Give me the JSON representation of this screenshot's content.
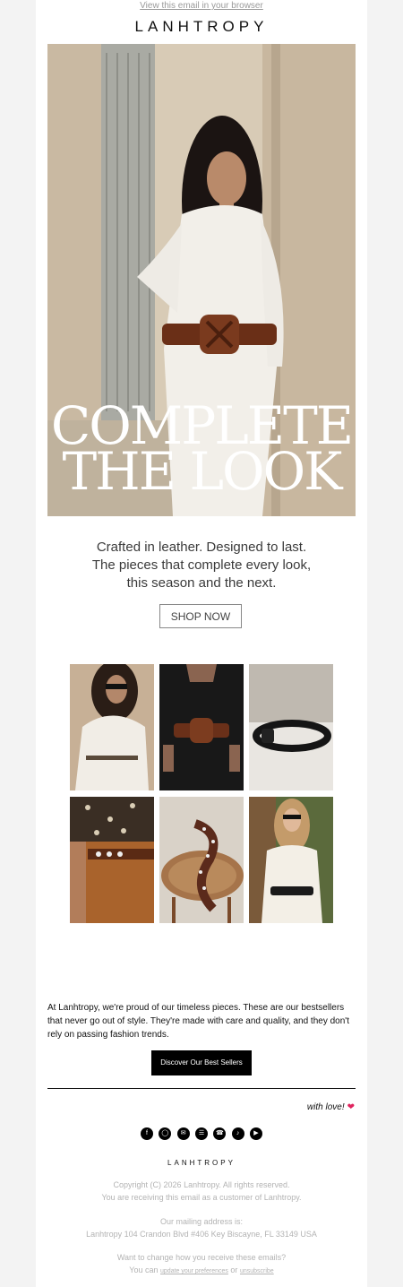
{
  "header": {
    "view_link": "View this email in your browser",
    "logo": "LANHTROPY"
  },
  "hero": {
    "line1": "COMPLETE",
    "line2": "THE LOOK"
  },
  "intro": {
    "line1": "Crafted in leather. Designed to last.",
    "line2": "The pieces that complete every look,",
    "line3": "this season and the next.",
    "button": "SHOP NOW"
  },
  "gallery": {
    "items": [
      "woman-sunglasses-white-blouse",
      "black-outfit-brown-belt",
      "black-belt-product",
      "brown-belt-trousers",
      "belt-on-chair",
      "woman-black-belt-white-dress"
    ]
  },
  "bestsellers": {
    "text": "At Lanhtropy, we're proud of our timeless pieces. These are our bestsellers that never go out of style. They're made with care and quality, and they don't rely on passing fashion trends.",
    "button": "Discover Our Best Sellers"
  },
  "sign_off": "with love!",
  "socials": [
    "facebook-icon",
    "instagram-icon",
    "email-icon",
    "website-icon",
    "whatsapp-icon",
    "tiktok-icon",
    "youtube-icon"
  ],
  "footer": {
    "logo": "LANHTROPY",
    "copyright": "Copyright (C) 2026 Lanhtropy. All rights reserved.",
    "reason": "You are receiving this email as a customer of Lanhtropy.",
    "mailing_label": "Our mailing address is:",
    "address": "Lanhtropy 104 Crandon Blvd #406 Key Biscayne, FL 33149 USA",
    "change_q": "Want to change how you receive these emails?",
    "you_can": "You can",
    "update_link": "update your preferences",
    "or": "or",
    "unsubscribe_link": "unsubscribe"
  },
  "colors": {
    "background": "#f3f3f3",
    "email_bg": "#ffffff",
    "accent": "#000000",
    "heart": "#e0245e"
  }
}
